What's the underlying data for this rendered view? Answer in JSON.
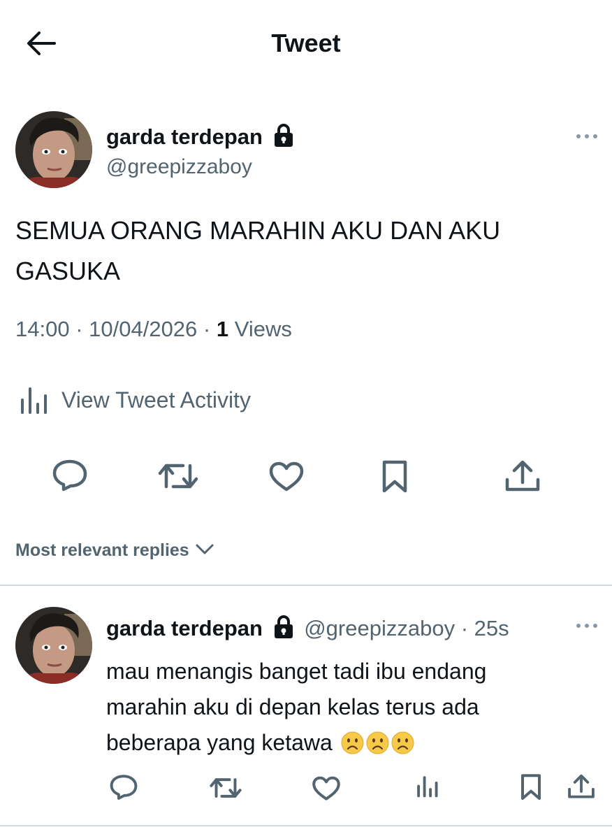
{
  "header": {
    "title": "Tweet"
  },
  "tweet": {
    "display_name": "garda terdepan",
    "handle": "@greepizzaboy",
    "text_line1": "SEMUA ORANG MARAHIN AKU DAN AKU",
    "text_line2": "GASUKA",
    "time": "14:00",
    "date": "10/04/2026",
    "views_count": "1",
    "views_label": "Views",
    "activity_label": "View Tweet Activity"
  },
  "replies_sort": {
    "label": "Most relevant replies"
  },
  "reply": {
    "display_name": "garda terdepan",
    "handle": "@greepizzaboy",
    "age": "25s",
    "text_line1": "mau menangis banget tadi ibu endang",
    "text_line2": "marahin aku di depan kelas terus ada",
    "text_line3": "beberapa yang ketawa",
    "emoji": "frowning-face-emoji"
  },
  "colors": {
    "text": "#0f1419",
    "secondary": "#536471",
    "divider": "#cfd9de",
    "emoji": "#f7c948"
  }
}
